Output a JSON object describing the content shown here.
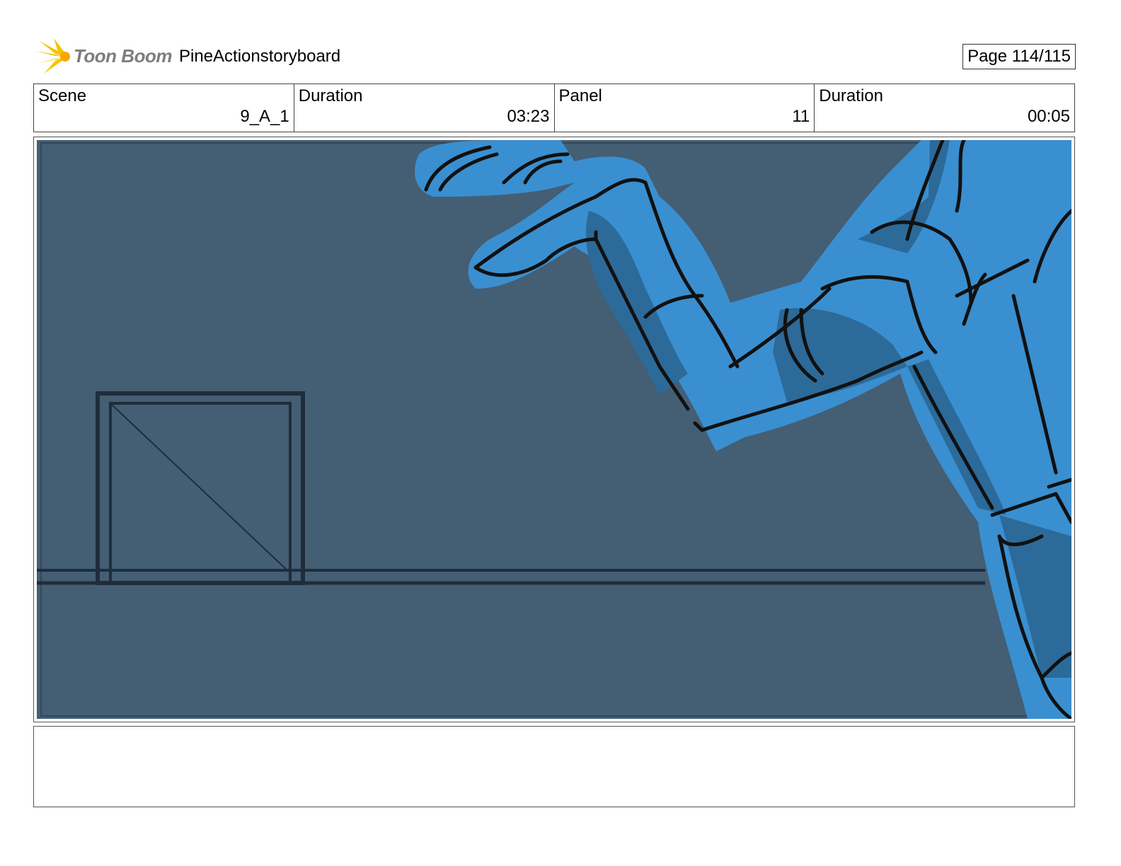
{
  "header": {
    "logo_text": "Toon Boom",
    "project_title": "PineActionstoryboard",
    "page_indicator": "Page 114/115"
  },
  "info": {
    "scene_label": "Scene",
    "scene_value": "9_A_1",
    "scene_duration_label": "Duration",
    "scene_duration_value": "03:23",
    "panel_label": "Panel",
    "panel_value": "11",
    "panel_duration_label": "Duration",
    "panel_duration_value": "00:05"
  },
  "panel": {
    "background_color": "#445e74",
    "character_color": "#3a8fd0",
    "character_shadow_color": "#2c6a99",
    "line_color": "#1f2d3a"
  },
  "notes": {
    "text": ""
  }
}
